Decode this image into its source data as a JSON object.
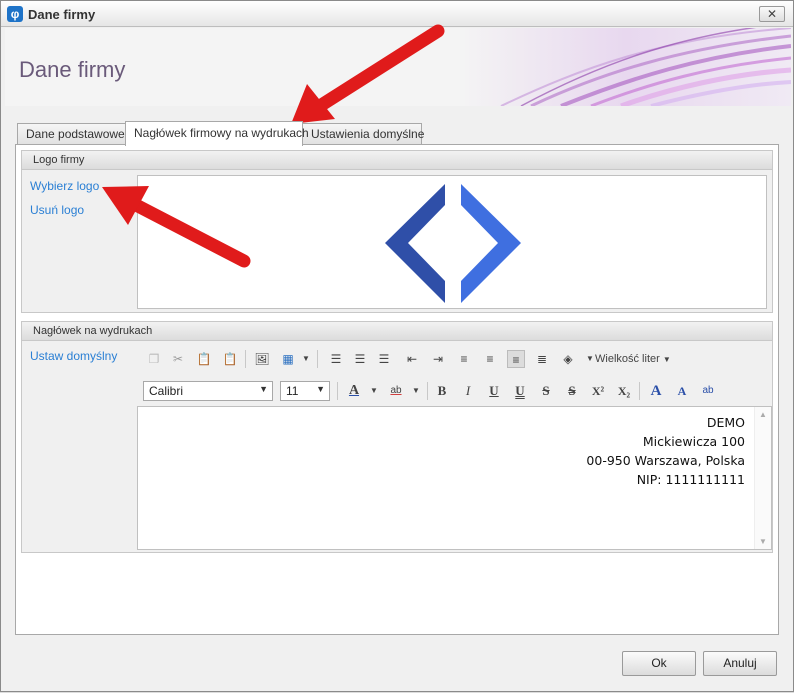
{
  "window": {
    "title": "Dane firmy",
    "close_label": "✕"
  },
  "banner": {
    "title": "Dane firmy"
  },
  "tabs": [
    {
      "label": "Dane podstawowe",
      "active": false
    },
    {
      "label": "Nagłówek firmowy na wydrukach",
      "active": true
    },
    {
      "label": "Ustawienia domyślne",
      "active": false
    }
  ],
  "logo_group": {
    "header": "Logo firmy",
    "choose_link": "Wybierz logo",
    "remove_link": "Usuń logo"
  },
  "header_group": {
    "header": "Nagłówek na wydrukach",
    "default_link": "Ustaw domyślny",
    "font_size_menu": "Wielkość liter",
    "font_name": "Calibri",
    "font_size": "11",
    "content_lines": [
      "DEMO",
      "Mickiewicza 100",
      "00-950 Warszawa, Polska",
      "NIP: 1111111111"
    ]
  },
  "toolbar_format": {
    "bold": "B",
    "italic": "I",
    "underline": "U",
    "double_underline": "U",
    "strike": "S",
    "double_strike": "S",
    "superscript": "X²",
    "subscript": "X₂",
    "font_color": "A",
    "grow_font": "A",
    "shrink_font": "A",
    "highlight": "ab"
  },
  "buttons": {
    "ok": "Ok",
    "cancel": "Anuluj"
  },
  "colors": {
    "link": "#2a7fd4",
    "logo_dark": "#2f4fa8",
    "logo_light": "#3f6fe0",
    "arrow": "#e01b1b"
  }
}
